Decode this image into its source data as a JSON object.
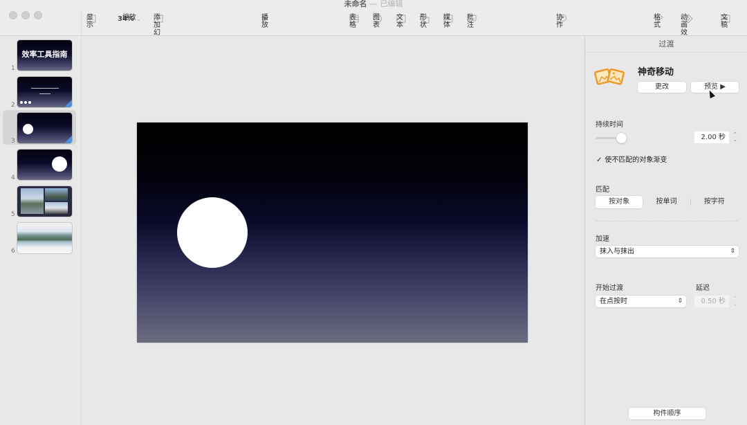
{
  "window": {
    "title": "未命名",
    "separator": "—",
    "status": "已编辑"
  },
  "toolbar": {
    "view": {
      "label": "显示",
      "icon": "sidebar-icon"
    },
    "zoom": {
      "label": "缩放",
      "value": "34%",
      "icon": "chevron-down-icon"
    },
    "add_slide": {
      "label": "添加幻灯片",
      "icon": "plus-square-icon"
    },
    "play": {
      "label": "播放",
      "icon": "play-icon"
    },
    "table": {
      "label": "表格",
      "icon": "table-icon"
    },
    "chart": {
      "label": "图表",
      "icon": "chart-icon"
    },
    "text": {
      "label": "文本",
      "icon": "text-box-icon"
    },
    "shape": {
      "label": "形状",
      "icon": "shape-icon"
    },
    "media": {
      "label": "媒体",
      "icon": "image-icon"
    },
    "comment": {
      "label": "批注",
      "icon": "comment-icon"
    },
    "collaborate": {
      "label": "协作",
      "icon": "collaborate-icon"
    },
    "format": {
      "label": "格式",
      "icon": "paintbrush-icon"
    },
    "animate": {
      "label": "动画效果",
      "icon": "diamond-icon"
    },
    "document": {
      "label": "文稿",
      "icon": "document-icon"
    }
  },
  "slides": [
    {
      "number": "1",
      "title": "效率工具指南",
      "selected": false
    },
    {
      "number": "2",
      "selected": false,
      "has_transition": true
    },
    {
      "number": "3",
      "selected": true,
      "has_transition": true
    },
    {
      "number": "4",
      "selected": false
    },
    {
      "number": "5",
      "selected": false
    },
    {
      "number": "6",
      "selected": false
    }
  ],
  "inspector": {
    "tab_title": "过渡",
    "effect": {
      "name": "神奇移动",
      "change_label": "更改",
      "preview_label": "预览 ▶"
    },
    "duration": {
      "label": "持续时间",
      "value": "2.00 秒",
      "slider_fraction": 0.2
    },
    "fade_unmatched": {
      "label": "使不匹配的对象渐变",
      "checked": true
    },
    "match": {
      "label": "匹配",
      "options": [
        "按对象",
        "按单词",
        "按字符"
      ],
      "selected": "按对象"
    },
    "acceleration": {
      "label": "加速",
      "value": "抹入与抹出"
    },
    "start_transition": {
      "label": "开始过渡",
      "value": "在点按时"
    },
    "delay": {
      "label": "延迟",
      "value": "0.50 秒",
      "enabled": false
    },
    "build_order_label": "构件顺序"
  },
  "colors": {
    "accent": "#4a90e2",
    "effect_icon": "#f0a030"
  }
}
